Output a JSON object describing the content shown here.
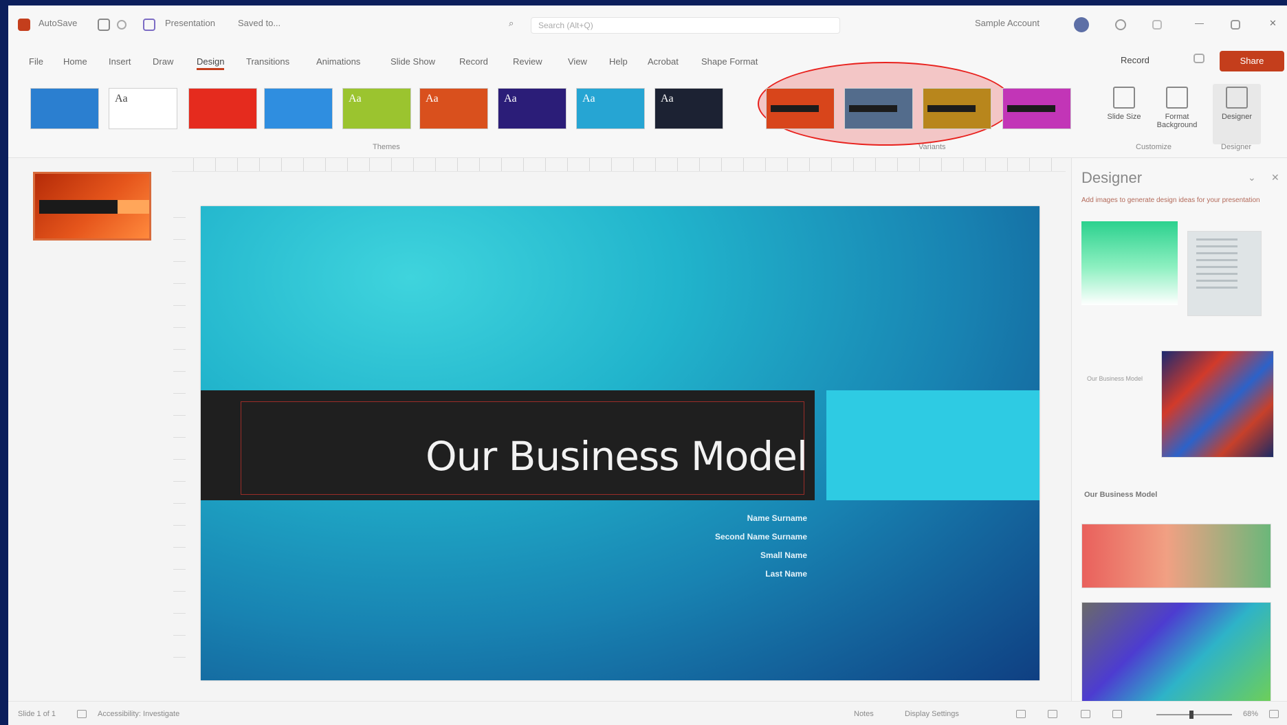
{
  "titlebar": {
    "autosave": "AutoSave",
    "doc_name": "Presentation",
    "saved_status": "Saved to...",
    "search_placeholder": "Search (Alt+Q)",
    "user": "Sample Account"
  },
  "ribbon_tabs": [
    "File",
    "Home",
    "Insert",
    "Draw",
    "Design",
    "Transitions",
    "Animations",
    "Slide Show",
    "Record",
    "Review",
    "View",
    "Help",
    "Acrobat",
    "Shape Format"
  ],
  "active_tab": "Design",
  "record_label": "Record",
  "share_label": "Share",
  "ribbon": {
    "themes_label": "Themes",
    "variants_label": "Variants",
    "customize_label": "Customize",
    "designer_label": "Designer",
    "themes": [
      {
        "name": "theme-office",
        "color": "#2b7fd0"
      },
      {
        "name": "theme-aa-white",
        "color": "#ffffff",
        "text": "Aa"
      },
      {
        "name": "theme-red",
        "color": "#e52b1e"
      },
      {
        "name": "theme-blue-stripe",
        "color": "#2f8ee0"
      },
      {
        "name": "theme-green",
        "color": "#9bc42f",
        "text": "Aa"
      },
      {
        "name": "theme-orange",
        "color": "#d9501d",
        "text": "Aa"
      },
      {
        "name": "theme-purple",
        "color": "#2b1d78",
        "text": "Aa"
      },
      {
        "name": "theme-teal",
        "color": "#26a5d3",
        "text": "Aa"
      },
      {
        "name": "theme-dark",
        "color": "#1c2233",
        "text": "Aa"
      }
    ],
    "variants": [
      {
        "name": "variant-orange",
        "color": "#d8451b"
      },
      {
        "name": "variant-slate",
        "color": "#536c8c"
      },
      {
        "name": "variant-gold",
        "color": "#b8861c"
      },
      {
        "name": "variant-magenta",
        "color": "#c235b7"
      }
    ],
    "slide_size_label": "Slide Size",
    "format_bg_label": "Format Background",
    "designer_btn_label": "Designer"
  },
  "slide": {
    "title": "Our Business Model",
    "subtitle_lines": [
      "Name Surname",
      "Second Name Surname",
      "Small Name",
      "Last Name"
    ]
  },
  "designer": {
    "title": "Designer",
    "subtitle": "Add images to generate design ideas for your presentation",
    "idea_label_1": "Our Business Model",
    "idea_label_2": "Our Business Model"
  },
  "statusbar": {
    "slide_info": "Slide 1 of 1",
    "accessibility": "Accessibility: Investigate",
    "notes": "Notes",
    "display_settings": "Display Settings",
    "zoom": "68%"
  }
}
